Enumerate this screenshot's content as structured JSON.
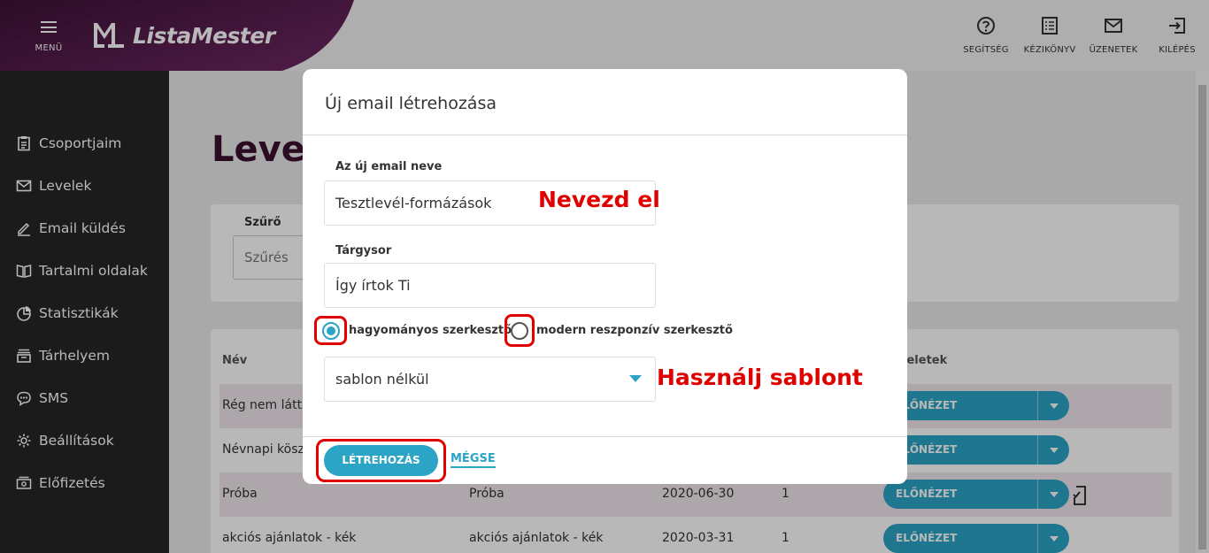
{
  "header": {
    "menu_label": "MENÜ",
    "brand": "ListaMester",
    "actions": [
      {
        "label": "SEGÍTSÉG",
        "icon": "help-circle-icon"
      },
      {
        "label": "KÉZIKÖNYV",
        "icon": "manual-icon"
      },
      {
        "label": "ÜZENETEK",
        "icon": "mail-icon"
      },
      {
        "label": "KILÉPÉS",
        "icon": "logout-icon"
      }
    ]
  },
  "sidebar": {
    "items": [
      {
        "label": "Csoportjaim",
        "icon": "clipboard-icon"
      },
      {
        "label": "Levelek",
        "icon": "envelope-icon"
      },
      {
        "label": "Email küldés",
        "icon": "pencil-icon"
      },
      {
        "label": "Tartalmi oldalak",
        "icon": "book-icon"
      },
      {
        "label": "Statisztikák",
        "icon": "pie-chart-icon"
      },
      {
        "label": "Tárhelyem",
        "icon": "storage-icon"
      },
      {
        "label": "SMS",
        "icon": "chat-bubble-icon"
      },
      {
        "label": "Beállítások",
        "icon": "gear-icon"
      },
      {
        "label": "Előfizetés",
        "icon": "cash-icon"
      }
    ]
  },
  "main": {
    "title": "Level",
    "filter": {
      "label": "Szűrő",
      "placeholder": "Szűrés"
    },
    "table": {
      "col_name": "Név",
      "col_actions": "veletek",
      "preview_label": "ELŐNÉZET",
      "rows": [
        {
          "name": "Rég nem látt",
          "subject": "",
          "date": "",
          "count": ""
        },
        {
          "name": "Névnapi kösz",
          "subject": "",
          "date": "",
          "count": ""
        },
        {
          "name": "Próba",
          "subject": "Próba",
          "date": "2020-06-30",
          "count": "1"
        },
        {
          "name": "akciós ajánlatok - kék",
          "subject": "akciós ajánlatok - kék",
          "date": "2020-03-31",
          "count": "1"
        }
      ]
    }
  },
  "dialog": {
    "title": "Új email létrehozása",
    "name_label": "Az új email neve",
    "name_value": "Tesztlevél-formázások",
    "subject_label": "Tárgysor",
    "subject_value": "Így írtok Ti",
    "editor_classic": "hagyományos szerkesztő",
    "editor_modern": "modern reszponzív szerkesztő",
    "selected_editor": "hagyományos szerkesztő",
    "template_value": "sablon nélkül",
    "create_label": "LÉTREHOZÁS",
    "cancel_label": "MÉGSE"
  },
  "annotations": {
    "name_hint": "Nevezd el",
    "template_hint": "Használj sablont"
  },
  "colors": {
    "accent": "#2ba4c6",
    "brand_purple": "#5b1f54",
    "annotation_red": "#e00000",
    "sidebar_bg": "#262626"
  }
}
